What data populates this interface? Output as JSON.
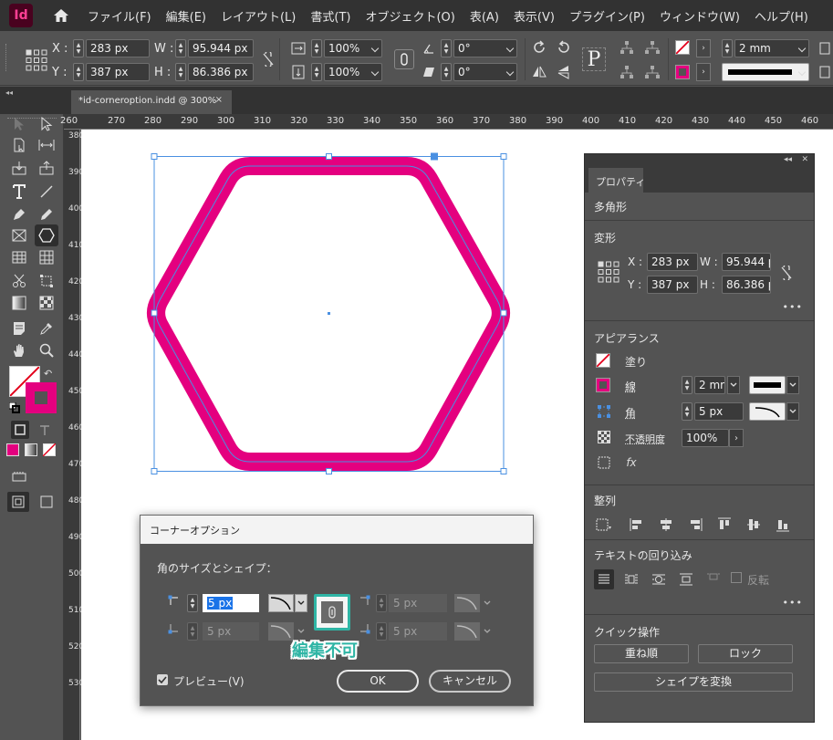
{
  "app": {
    "logo": "Id"
  },
  "menu": [
    "ファイル(F)",
    "編集(E)",
    "レイアウト(L)",
    "書式(T)",
    "オブジェクト(O)",
    "表(A)",
    "表示(V)",
    "プラグイン(P)",
    "ウィンドウ(W)",
    "ヘルプ(H)"
  ],
  "control": {
    "x_label": "X :",
    "x_value": "283 px",
    "y_label": "Y :",
    "y_value": "387 px",
    "w_label": "W :",
    "w_value": "95.944 px",
    "h_label": "H :",
    "h_value": "86.386 px",
    "scale_x": "100%",
    "scale_y": "100%",
    "rotation": "0°",
    "shear": "0°",
    "stroke_weight": "2 mm"
  },
  "document_tab": {
    "title": "*id-corneroption.indd @ 300%",
    "close": "×"
  },
  "ruler_top": [
    "260",
    "270",
    "280",
    "290",
    "300",
    "310",
    "320",
    "330",
    "340",
    "350",
    "360",
    "370",
    "380",
    "390",
    "400",
    "410",
    "420",
    "430",
    "440",
    "450",
    "460"
  ],
  "ruler_left": [
    "380",
    "390",
    "400",
    "410",
    "420",
    "430",
    "440",
    "450",
    "460",
    "470",
    "480",
    "490",
    "500",
    "510",
    "520",
    "530"
  ],
  "properties": {
    "tab": "プロパティ",
    "object_type": "多角形",
    "transform": {
      "title": "変形",
      "x_label": "X :",
      "x_value": "283 px",
      "y_label": "Y :",
      "y_value": "387 px",
      "w_label": "W :",
      "w_value": "95.944 p",
      "h_label": "H :",
      "h_value": "86.386 p"
    },
    "appearance": {
      "title": "アピアランス",
      "fill_label": "塗り",
      "stroke_label": "線",
      "stroke_weight": "2 mr",
      "corner_label": "角",
      "corner_size": "5 px",
      "opacity_label": "不透明度",
      "opacity_value": "100%"
    },
    "align": {
      "title": "整列"
    },
    "text_wrap": {
      "title": "テキストの回り込み",
      "invert_label": "反転"
    },
    "quick_actions": {
      "title": "クイック操作",
      "arrange": "重ね順",
      "lock": "ロック",
      "convert_shape": "シェイプを変換"
    },
    "more": "•••"
  },
  "dialog": {
    "title": "コーナーオプション",
    "section_label": "角のサイズとシェイプ：",
    "tl_size": "5 px",
    "tr_size": "5 px",
    "bl_size": "5 px",
    "br_size": "5 px",
    "preview_label": "プレビュー(V)",
    "ok": "OK",
    "cancel": "キャンセル"
  },
  "annotation": {
    "label": "編集不可",
    "color": "#2fb5a5"
  },
  "colors": {
    "accent": "#e4007f",
    "selection": "#4a90e2"
  }
}
